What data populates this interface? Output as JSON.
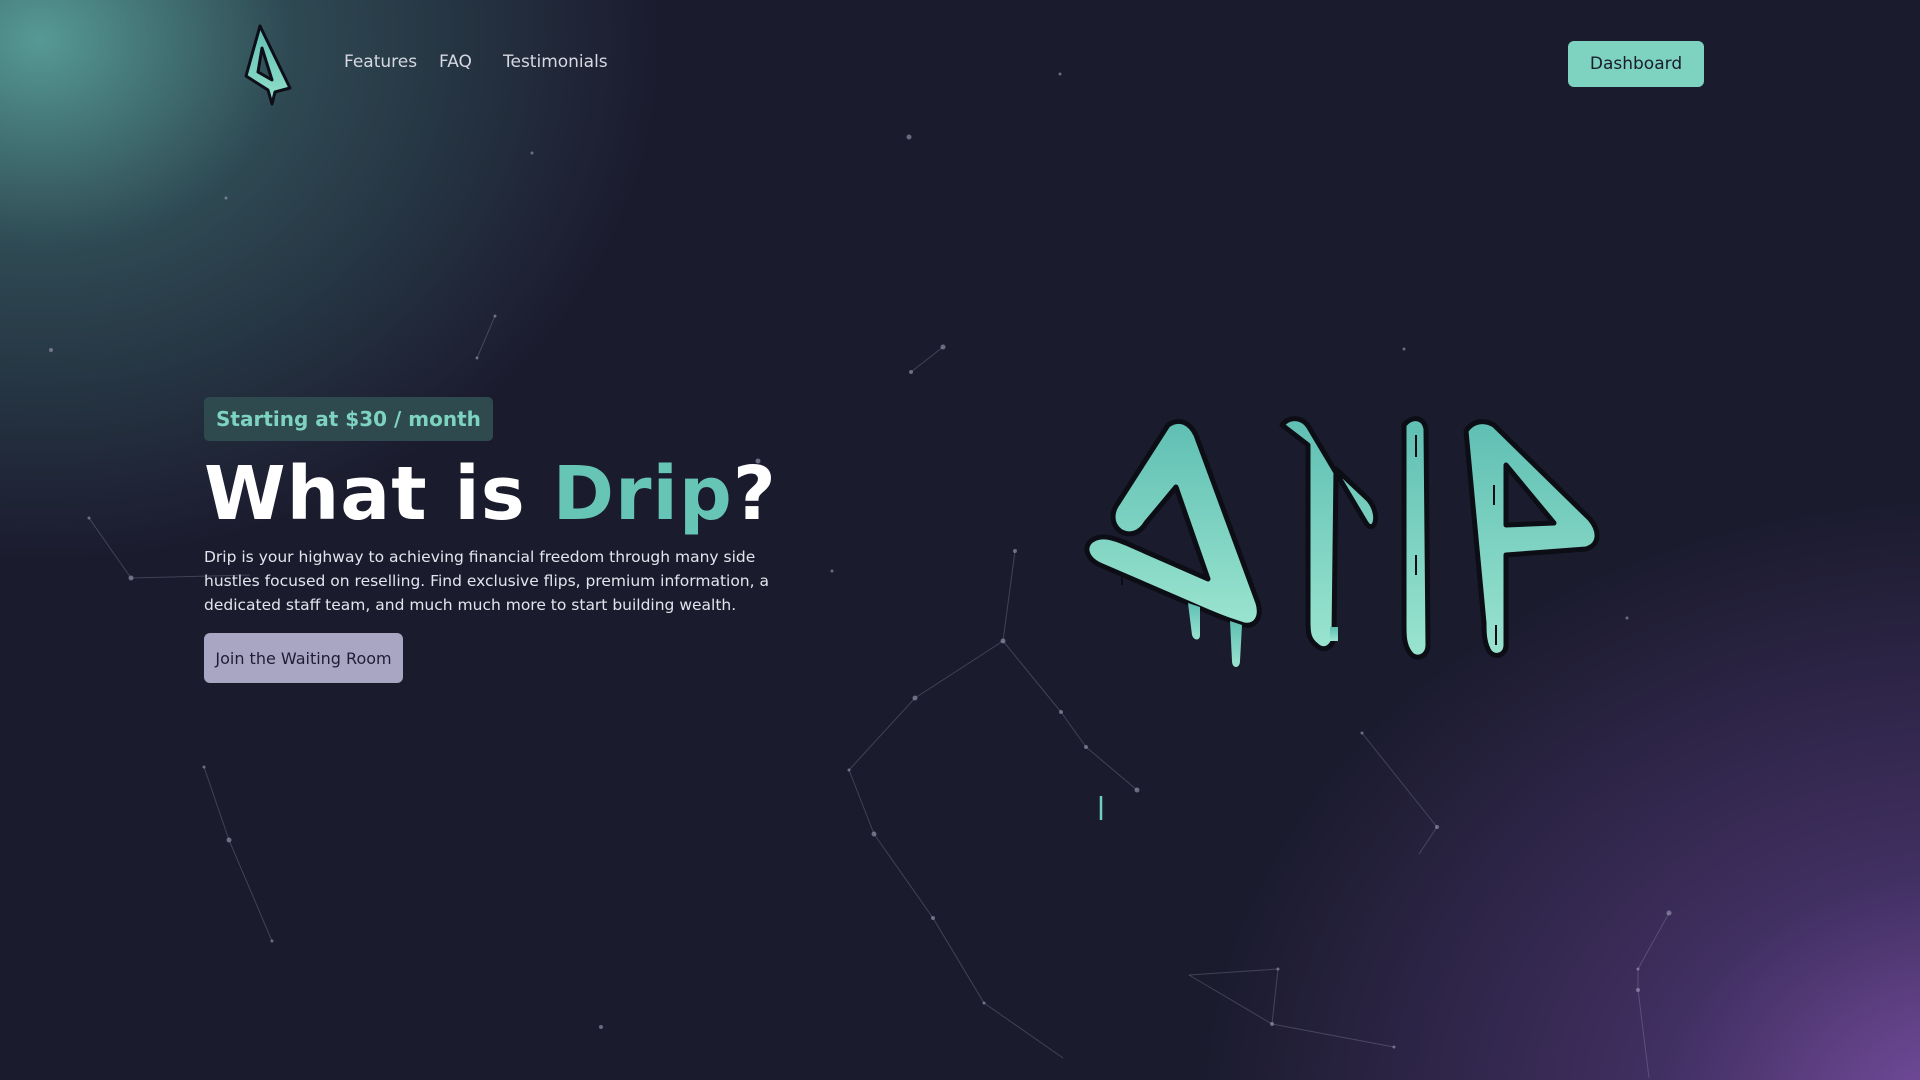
{
  "brand": {
    "logo_icon": "drip-logo-icon",
    "wordmark_art": "drip-graffiti-wordmark",
    "accent_color": "#7dd3c0",
    "title_accent_color": "#67c5b5",
    "background_color": "#1b1b2e"
  },
  "nav": {
    "links": [
      "Features",
      "FAQ",
      "Testimonials"
    ],
    "dashboard_label": "Dashboard"
  },
  "hero": {
    "price_badge": "Starting at $30 / month",
    "title_prefix": "What is ",
    "title_accent": "Drip",
    "title_suffix": "?",
    "description": "Drip is your highway to achieving financial freedom through many side hustles focused on reselling. Find exclusive flips, premium information, a dedicated staff team, and much much more to start building wealth.",
    "cta_label": "Join the Waiting Room"
  }
}
